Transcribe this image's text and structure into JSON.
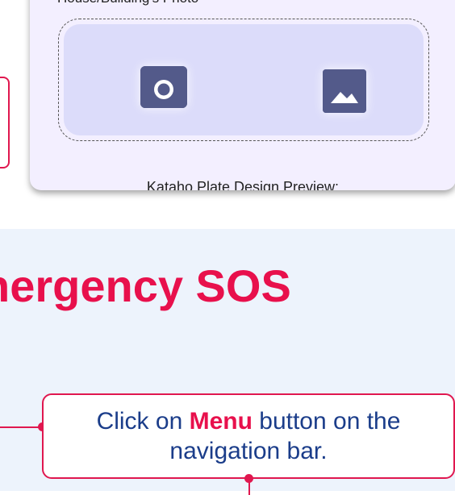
{
  "form": {
    "photo_label": "House/Building's Photo",
    "preview_label": "Kataho Plate Design Preview:"
  },
  "icons": {
    "camera": "camera-icon",
    "gallery": "image-gallery-icon"
  },
  "section": {
    "title": "nergency SOS"
  },
  "instruction": {
    "prefix": "Click on ",
    "highlight": "Menu",
    "suffix_line1": " button on the",
    "line2": "navigation bar."
  },
  "colors": {
    "accent": "#e8104c",
    "text_blue": "#1b3d8a",
    "icon_fill": "#535a8a",
    "photo_bg": "#dcdcfa",
    "card_bg": "#f3efff",
    "section_bg": "#edf3fc"
  }
}
